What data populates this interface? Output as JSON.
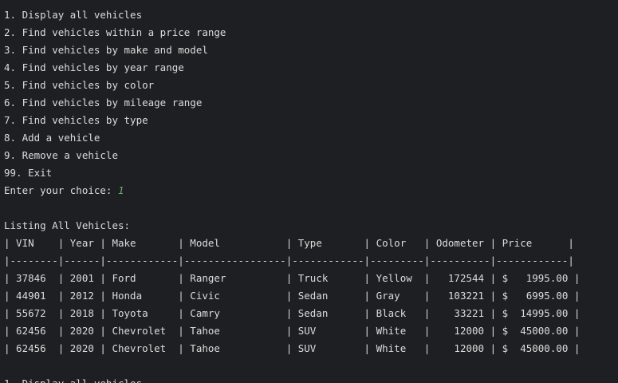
{
  "menu": [
    "1. Display all vehicles",
    "2. Find vehicles within a price range",
    "3. Find vehicles by make and model",
    "4. Find vehicles by year range",
    "5. Find vehicles by color",
    "6. Find vehicles by mileage range",
    "7. Find vehicles by type",
    "8. Add a vehicle",
    "9. Remove a vehicle",
    "99. Exit"
  ],
  "prompt": "Enter your choice: ",
  "choice": "1",
  "listing_title": "Listing All Vehicles:",
  "table_header": "| VIN    | Year | Make       | Model           | Type       | Color   | Odometer | Price      |",
  "table_separator": "|--------|------|------------|-----------------|------------|---------|----------|------------|",
  "table_rows": [
    "| 37846  | 2001 | Ford       | Ranger          | Truck      | Yellow  |   172544 | $   1995.00 |",
    "| 44901  | 2012 | Honda      | Civic           | Sedan      | Gray    |   103221 | $   6995.00 |",
    "| 55672  | 2018 | Toyota     | Camry           | Sedan      | Black   |    33221 | $  14995.00 |",
    "| 62456  | 2020 | Chevrolet  | Tahoe           | SUV        | White   |    12000 | $  45000.00 |",
    "| 62456  | 2020 | Chevrolet  | Tahoe           | SUV        | White   |    12000 | $  45000.00 |"
  ],
  "menu_repeat_partial": "1. Display all vehicles",
  "colors": {
    "background": "#1e1f22",
    "text": "#dcdcdc",
    "input": "#6aab73"
  }
}
